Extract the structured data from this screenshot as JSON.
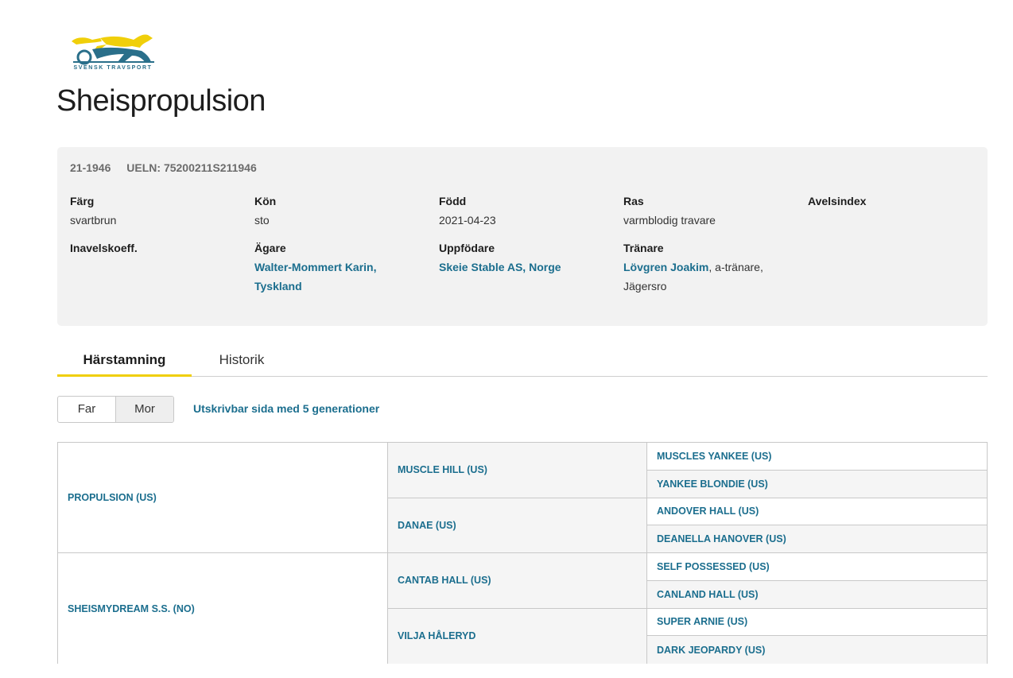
{
  "logo": {
    "text": "SVENSK TRAVSPORT"
  },
  "horse": {
    "name": "Sheispropulsion",
    "reg_no": "21-1946",
    "ueln": "UELN: 75200211S211946"
  },
  "info": {
    "color_label": "Färg",
    "color_value": "svartbrun",
    "sex_label": "Kön",
    "sex_value": "sto",
    "born_label": "Född",
    "born_value": "2021-04-23",
    "breed_label": "Ras",
    "breed_value": "varmblodig travare",
    "index_label": "Avelsindex",
    "inbreeding_label": "Inavelskoeff.",
    "owner_label": "Ägare",
    "owner_line1": "Walter-Mommert Karin,",
    "owner_line2": "Tyskland",
    "breeder_label": "Uppfödare",
    "breeder_value": "Skeie Stable AS, Norge",
    "trainer_label": "Tränare",
    "trainer_name": "Lövgren Joakim",
    "trainer_role": ", a-tränare,",
    "trainer_place": "Jägersro"
  },
  "tabs": [
    {
      "label": "Härstamning"
    },
    {
      "label": "Historik"
    }
  ],
  "toggle": {
    "far": "Far",
    "mor": "Mor"
  },
  "print_link": "Utskrivbar sida med 5 generationer",
  "pedigree": {
    "gen1": [
      "PROPULSION (US)",
      "SHEISMYDREAM S.S. (NO)"
    ],
    "gen2": [
      "MUSCLE HILL (US)",
      "DANAE (US)",
      "CANTAB HALL (US)",
      "VILJA HÅLERYD"
    ],
    "gen3": [
      "MUSCLES YANKEE (US)",
      "YANKEE BLONDIE (US)",
      "ANDOVER HALL (US)",
      "DEANELLA HANOVER (US)",
      "SELF POSSESSED (US)",
      "CANLAND HALL (US)",
      "SUPER ARNIE (US)",
      "DARK JEOPARDY (US)"
    ]
  },
  "colors": {
    "link": "#1b6e8e",
    "accent": "#f0cf0a",
    "panel": "#f2f2f2"
  }
}
